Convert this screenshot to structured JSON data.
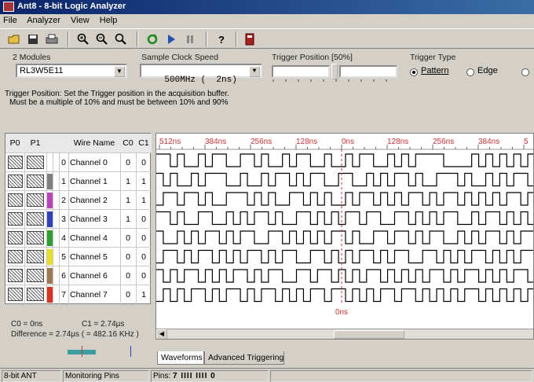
{
  "window": {
    "title": "Ant8 - 8-bit Logic Analyzer"
  },
  "menu": [
    "File",
    "Analyzer",
    "View",
    "Help"
  ],
  "toolbar_icons": [
    "open-icon",
    "save-icon",
    "print-icon",
    "zoom-in-icon",
    "zoom-out-icon",
    "zoom-fit-icon",
    "refresh-icon",
    "run-icon",
    "pause-icon",
    "help-icon",
    "stop-icon"
  ],
  "settings": {
    "modules_label": "2 Modules",
    "modules_value": "RL3W5E11",
    "clock_label": "Sample Clock Speed",
    "clock_value": "500MHz (  2ns)",
    "trigger_pos_label": "Trigger Position [50%]",
    "trigger_position_percent": 50,
    "trigger_type_label": "Trigger Type",
    "trigger_types": [
      {
        "label": "Pattern",
        "selected": true
      },
      {
        "label": "Edge",
        "selected": false
      }
    ]
  },
  "help": {
    "line1": "Trigger Position: Set the Trigger position in the acquisition buffer.",
    "line2": "Must be a multiple of 10% and must be between 10% and 90%"
  },
  "table": {
    "headers": {
      "p0": "P0",
      "p1": "P1",
      "wire": "Wire Name",
      "c0": "C0",
      "c1": "C1"
    },
    "rows": [
      {
        "idx": "0",
        "name": "Channel 0",
        "c0": "0",
        "c1": "0",
        "color": "#ffffff"
      },
      {
        "idx": "1",
        "name": "Channel 1",
        "c0": "1",
        "c1": "1",
        "color": "#808080"
      },
      {
        "idx": "2",
        "name": "Channel 2",
        "c0": "1",
        "c1": "1",
        "color": "#c040c0"
      },
      {
        "idx": "3",
        "name": "Channel 3",
        "c0": "1",
        "c1": "0",
        "color": "#3040c0"
      },
      {
        "idx": "4",
        "name": "Channel 4",
        "c0": "0",
        "c1": "0",
        "color": "#30a030"
      },
      {
        "idx": "5",
        "name": "Channel 5",
        "c0": "0",
        "c1": "0",
        "color": "#e8e020"
      },
      {
        "idx": "6",
        "name": "Channel 6",
        "c0": "0",
        "c1": "0",
        "color": "#a07850"
      },
      {
        "idx": "7",
        "name": "Channel 7",
        "c0": "0",
        "c1": "1",
        "color": "#e03020"
      }
    ]
  },
  "ruler": {
    "labels": [
      "512ns",
      "384ns",
      "256ns",
      "128ns",
      "0ns",
      "128ns",
      "256ns",
      "384ns",
      "5"
    ],
    "trigger_label": "0ns"
  },
  "cursors": {
    "c0": "C0 = 0ns",
    "c1": "C1 = 2.74µs",
    "difference": "Difference = 2.74µs ( = 482.16 KHz )"
  },
  "tabs": [
    "Waveforms",
    "Advanced Triggering"
  ],
  "status": {
    "device": "8-bit ANT",
    "mode": "Monitoring Pins",
    "pins_label": "Pins:",
    "pins_value": "7 IIII IIII 0"
  },
  "waveforms": [
    "110100101100110100101100100101100101011110000101010101",
    "101001011100100101101011001100101011010011101001010110",
    "011011010011101010011010100101101010110101101010101101",
    "110100110010101101001101010110110011010101100101101010",
    "100101011010110011010101011010011011010110010101101011",
    "011010110101011010110011010101101011001101010110101011",
    "101011010101101011001101101010110101010110101101010110",
    "010101101011010110101011011010101101101010101101010101"
  ]
}
